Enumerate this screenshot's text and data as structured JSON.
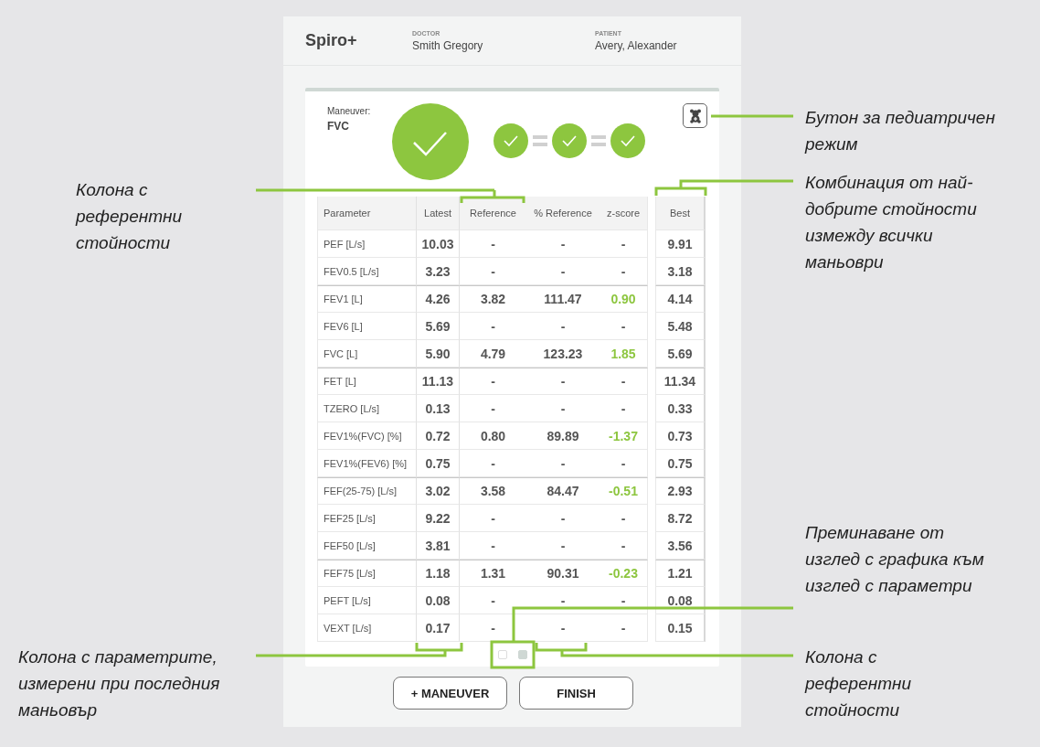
{
  "header": {
    "app_name": "Spiro+",
    "doctor_label": "DOCTOR",
    "doctor": "Smith Gregory",
    "patient_label": "PATIENT",
    "patient": "Avery, Alexander"
  },
  "maneuver": {
    "label": "Maneuver:",
    "name": "FVC",
    "passed": true,
    "checks": [
      {
        "passed": true
      },
      {
        "passed": true
      },
      {
        "passed": true
      }
    ]
  },
  "table": {
    "columns": [
      "Parameter",
      "Latest",
      "Reference",
      "% Reference",
      "z-score"
    ],
    "best_column": "Best",
    "rows": [
      {
        "parameter": "PEF [L/s]",
        "latest": "10.03",
        "reference": "-",
        "pct_reference": "-",
        "z_score": "-",
        "z_highlight": false,
        "best": "9.91",
        "divider_above": false
      },
      {
        "parameter": "FEV0.5 [L/s]",
        "latest": "3.23",
        "reference": "-",
        "pct_reference": "-",
        "z_score": "-",
        "z_highlight": false,
        "best": "3.18",
        "divider_above": false
      },
      {
        "parameter": "FEV1 [L]",
        "latest": "4.26",
        "reference": "3.82",
        "pct_reference": "111.47",
        "z_score": "0.90",
        "z_highlight": true,
        "best": "4.14",
        "divider_above": true
      },
      {
        "parameter": "FEV6 [L]",
        "latest": "5.69",
        "reference": "-",
        "pct_reference": "-",
        "z_score": "-",
        "z_highlight": false,
        "best": "5.48",
        "divider_above": false
      },
      {
        "parameter": "FVC [L]",
        "latest": "5.90",
        "reference": "4.79",
        "pct_reference": "123.23",
        "z_score": "1.85",
        "z_highlight": true,
        "best": "5.69",
        "divider_above": false
      },
      {
        "parameter": "FET [L]",
        "latest": "11.13",
        "reference": "-",
        "pct_reference": "-",
        "z_score": "-",
        "z_highlight": false,
        "best": "11.34",
        "divider_above": true
      },
      {
        "parameter": "TZERO [L/s]",
        "latest": "0.13",
        "reference": "-",
        "pct_reference": "-",
        "z_score": "-",
        "z_highlight": false,
        "best": "0.33",
        "divider_above": false
      },
      {
        "parameter": "FEV1%(FVC) [%]",
        "latest": "0.72",
        "reference": "0.80",
        "pct_reference": "89.89",
        "z_score": "-1.37",
        "z_highlight": true,
        "best": "0.73",
        "divider_above": false
      },
      {
        "parameter": "FEV1%(FEV6) [%]",
        "latest": "0.75",
        "reference": "-",
        "pct_reference": "-",
        "z_score": "-",
        "z_highlight": false,
        "best": "0.75",
        "divider_above": false
      },
      {
        "parameter": "FEF(25-75) [L/s]",
        "latest": "3.02",
        "reference": "3.58",
        "pct_reference": "84.47",
        "z_score": "-0.51",
        "z_highlight": true,
        "best": "2.93",
        "divider_above": true
      },
      {
        "parameter": "FEF25 [L/s]",
        "latest": "9.22",
        "reference": "-",
        "pct_reference": "-",
        "z_score": "-",
        "z_highlight": false,
        "best": "8.72",
        "divider_above": false
      },
      {
        "parameter": "FEF50 [L/s]",
        "latest": "3.81",
        "reference": "-",
        "pct_reference": "-",
        "z_score": "-",
        "z_highlight": false,
        "best": "3.56",
        "divider_above": false
      },
      {
        "parameter": "FEF75 [L/s]",
        "latest": "1.18",
        "reference": "1.31",
        "pct_reference": "90.31",
        "z_score": "-0.23",
        "z_highlight": true,
        "best": "1.21",
        "divider_above": true
      },
      {
        "parameter": "PEFT [L/s]",
        "latest": "0.08",
        "reference": "-",
        "pct_reference": "-",
        "z_score": "-",
        "z_highlight": false,
        "best": "0.08",
        "divider_above": false
      },
      {
        "parameter": "VEXT [L/s]",
        "latest": "0.17",
        "reference": "-",
        "pct_reference": "-",
        "z_score": "-",
        "z_highlight": false,
        "best": "0.15",
        "divider_above": false
      }
    ]
  },
  "pages": [
    {
      "selected": false
    },
    {
      "selected": true
    }
  ],
  "buttons": [
    "+ MANEUVER",
    "FINISH"
  ],
  "annotations": [
    "Колона с референтни стойности",
    "Бутон за педиатричен режим",
    "Комбинация от най-добрите стойности измежду всички маньоври",
    "Преминаване от изглед с графика към изглед с параметри",
    "Колона с параметрите, измерени при последния маньовър",
    "Колона с референтни стойности"
  ]
}
